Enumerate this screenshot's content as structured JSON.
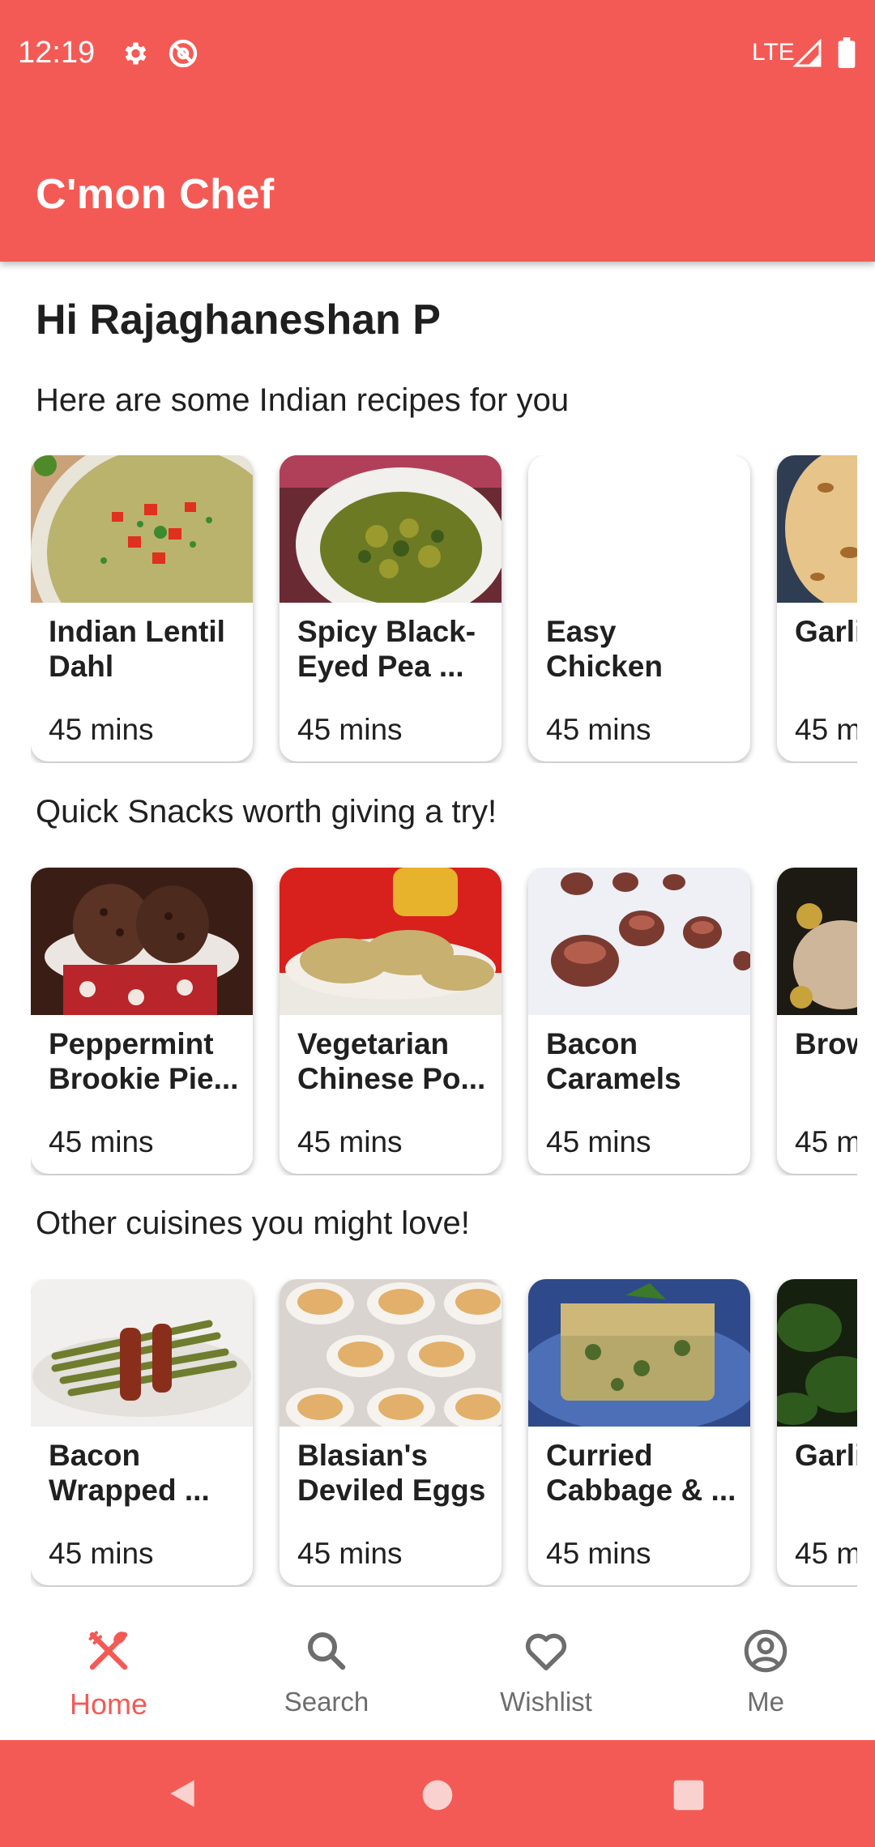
{
  "status_bar": {
    "time": "12:19",
    "network": "LTE"
  },
  "app": {
    "title": "C'mon Chef"
  },
  "greeting": "Hi Rajaghaneshan P",
  "sections": [
    {
      "title": "Here are some Indian recipes for you",
      "cards": [
        {
          "name": "Indian Lentil Dahl",
          "time": "45 mins"
        },
        {
          "name": "Spicy Black-Eyed Pea ...",
          "time": "45 mins"
        },
        {
          "name": "Easy Chicken Tikka Masala",
          "time": "45 mins"
        },
        {
          "name": "Garlic Naan",
          "time": "45 mins"
        }
      ]
    },
    {
      "title": "Quick Snacks worth giving a try!",
      "cards": [
        {
          "name": "Peppermint Brookie Pie...",
          "time": "45 mins"
        },
        {
          "name": "Vegetarian Chinese Po...",
          "time": "45 mins"
        },
        {
          "name": "Bacon Caramels",
          "time": "45 mins"
        },
        {
          "name": "Brown Spon",
          "time": "45 mins"
        }
      ]
    },
    {
      "title": "Other cuisines you might love!",
      "cards": [
        {
          "name": "Bacon Wrapped ...",
          "time": "45 mins"
        },
        {
          "name": "Blasian's Deviled Eggs",
          "time": "45 mins"
        },
        {
          "name": "Curried Cabbage & ...",
          "time": "45 mins"
        },
        {
          "name": "Garlic",
          "time": "45 mins"
        }
      ]
    }
  ],
  "bottom_nav": [
    {
      "label": "Home",
      "icon": "fork-spoon-icon",
      "active": true
    },
    {
      "label": "Search",
      "icon": "search-icon",
      "active": false
    },
    {
      "label": "Wishlist",
      "icon": "heart-icon",
      "active": false
    },
    {
      "label": "Me",
      "icon": "account-circle-icon",
      "active": false
    }
  ],
  "colors": {
    "primary": "#f45a55",
    "text": "#202020",
    "inactive": "#6d6d6d"
  }
}
